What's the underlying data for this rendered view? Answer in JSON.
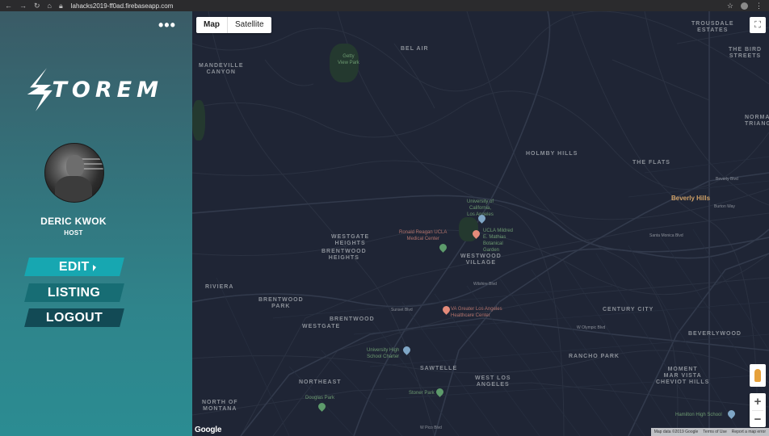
{
  "browser": {
    "url": "lahacks2019-ff0ad.firebaseapp.com"
  },
  "sidebar": {
    "logo_text": "TOREM",
    "user_name": "DERIC KWOK",
    "user_role": "HOST",
    "menu": [
      {
        "label": "EDIT"
      },
      {
        "label": "LISTING"
      },
      {
        "label": "LOGOUT"
      }
    ]
  },
  "map": {
    "type_buttons": {
      "map": "Map",
      "satellite": "Satellite"
    },
    "logo": "Google",
    "attribution": {
      "data": "Map data ©2019 Google",
      "terms": "Terms of Use",
      "report": "Report a map error"
    },
    "labels": {
      "bel_air": "BEL AIR",
      "mandeville": "MANDEVILLE\nCANYON",
      "holmby_hills": "HOLMBY HILLS",
      "the_flats": "THE FLATS",
      "beverly_hills": "Beverly Hills",
      "westgate_heights": "WESTGATE\nHEIGHTS",
      "brentwood_heights": "BRENTWOOD\nHEIGHTS",
      "westwood": "WESTWOOD",
      "westwood_village": "WESTWOOD\nVILLAGE",
      "riviera": "RIVIERA",
      "brentwood_park": "BRENTWOOD\nPARK",
      "westgate": "WESTGATE",
      "brentwood": "BRENTWOOD",
      "century_city": "CENTURY CITY",
      "beverlywood": "BEVERLYWOOD",
      "rancho_park": "RANCHO PARK",
      "sawtelle": "SAWTELLE",
      "northeast": "NORTHEAST",
      "west_la": "WEST LOS\nANGELES",
      "north_of_montana": "NORTH OF\nMONTANA",
      "mar_vista": "MOMENT\nMAR VISTA\nCHEVIOT HILLS",
      "trousdale": "TROUSDALE\nESTATES",
      "bird_streets": "THE BIRD\nSTREETS",
      "normandie": "NORMA\nTRIANG",
      "gefty": "Getty\nView Park",
      "ucla": "University of\nCalifornia,\nLos Angeles",
      "ronald_reagan": "Ronald Reagan UCLA\nMedical Center",
      "botanical": "UCLA Mildred\nE. Mathias\nBotanical\nGarden",
      "va": "VA Greater Los Angeles\nHealthcare Center",
      "uni_high": "University High\nSchool Charter",
      "stoner_park": "Stoner Park",
      "douglas_park": "Douglas Park",
      "hamilton": "Hamilton High School",
      "sunset": "Sunset Blvd",
      "wilshire": "Wilshire Blvd",
      "olympic": "W Olympic Blvd",
      "pico": "W Pico Blvd",
      "sm_blvd": "Santa Monica Blvd",
      "beverly_blvd": "Beverly Blvd",
      "burton": "Burton Way"
    }
  }
}
